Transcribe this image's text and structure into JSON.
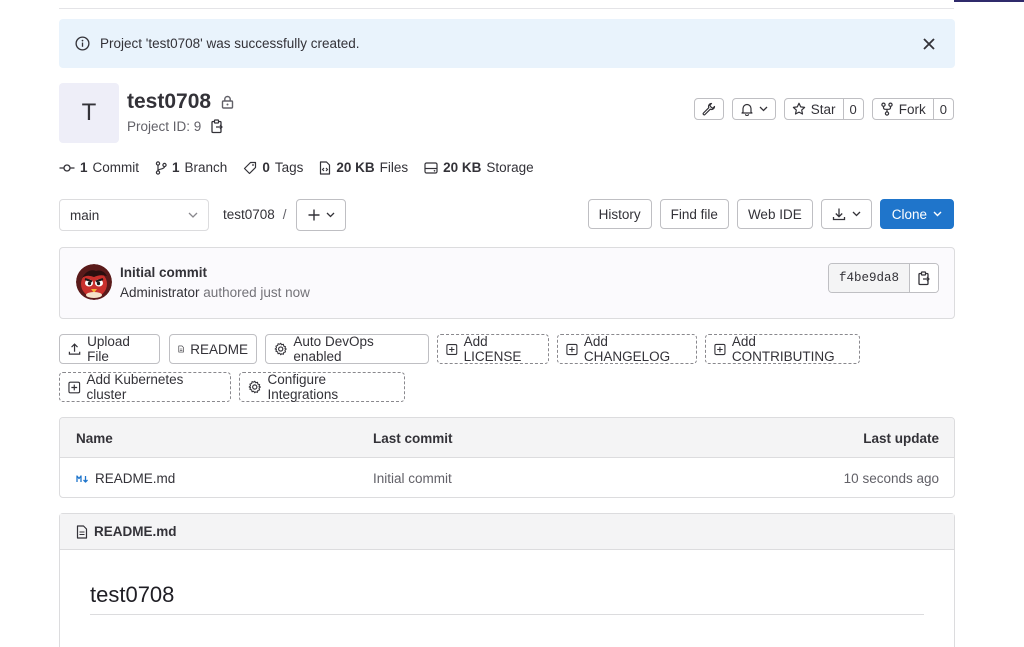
{
  "alert": {
    "message": "Project 'test0708' was successfully created."
  },
  "project": {
    "avatar_letter": "T",
    "name": "test0708",
    "id_label": "Project ID: 9"
  },
  "actions": {
    "star_label": "Star",
    "star_count": "0",
    "fork_label": "Fork",
    "fork_count": "0"
  },
  "stats": {
    "commits_num": "1",
    "commits_label": "Commit",
    "branches_num": "1",
    "branches_label": "Branch",
    "tags_num": "0",
    "tags_label": "Tags",
    "files_num": "20 KB",
    "files_label": "Files",
    "storage_num": "20 KB",
    "storage_label": "Storage"
  },
  "repo_nav": {
    "branch": "main",
    "path": "test0708",
    "separator": "/",
    "history": "History",
    "find_file": "Find file",
    "web_ide": "Web IDE",
    "clone": "Clone"
  },
  "last_commit": {
    "title": "Initial commit",
    "author": "Administrator",
    "meta": "authored just now",
    "sha": "f4be9da8"
  },
  "quick_actions": [
    "Upload File",
    "README",
    "Auto DevOps enabled",
    "Add LICENSE",
    "Add CHANGELOG",
    "Add CONTRIBUTING",
    "Add Kubernetes cluster",
    "Configure Integrations"
  ],
  "file_table": {
    "headers": {
      "name": "Name",
      "last_commit": "Last commit",
      "last_update": "Last update"
    },
    "rows": [
      {
        "name": "README.md",
        "commit": "Initial commit",
        "updated": "10 seconds ago"
      }
    ]
  },
  "readme": {
    "filename": "README.md",
    "heading": "test0708"
  },
  "colors": {
    "primary": "#1f75cb",
    "alert_bg": "#e9f3fc",
    "border": "#dcdcde"
  }
}
